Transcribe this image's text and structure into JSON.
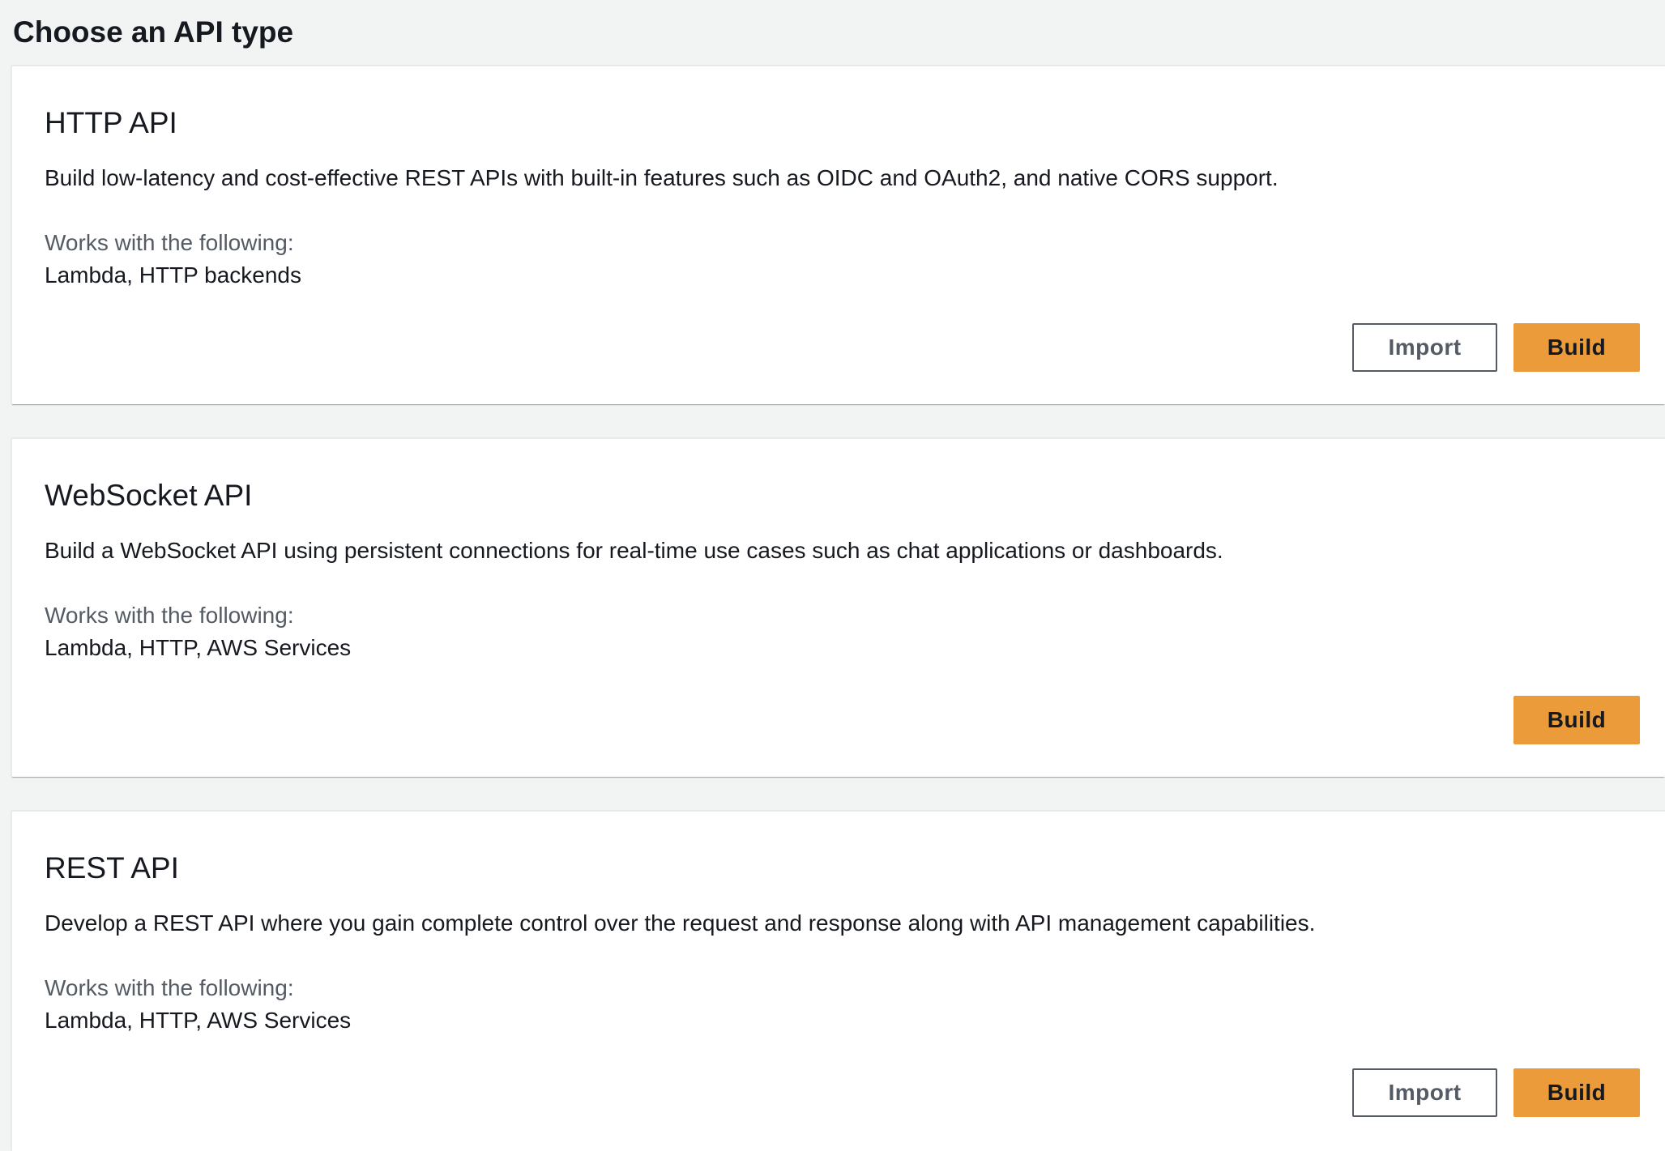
{
  "page": {
    "title": "Choose an API type"
  },
  "cards": [
    {
      "title": "HTTP API",
      "description": "Build low-latency and cost-effective REST APIs with built-in features such as OIDC and OAuth2, and native CORS support.",
      "works_label": "Works with the following:",
      "works_value": "Lambda, HTTP backends",
      "import_label": "Import",
      "build_label": "Build"
    },
    {
      "title": "WebSocket API",
      "description": "Build a WebSocket API using persistent connections for real-time use cases such as chat applications or dashboards.",
      "works_label": "Works with the following:",
      "works_value": "Lambda, HTTP, AWS Services",
      "build_label": "Build"
    },
    {
      "title": "REST API",
      "description": "Develop a REST API where you gain complete control over the request and response along with API management capabilities.",
      "works_label": "Works with the following:",
      "works_value": "Lambda, HTTP, AWS Services",
      "import_label": "Import",
      "build_label": "Build"
    }
  ],
  "colors": {
    "page_background": "#f2f3f3",
    "primary_button": "#ec9b3a",
    "text": "#16191f",
    "secondary_text": "#545b64"
  }
}
